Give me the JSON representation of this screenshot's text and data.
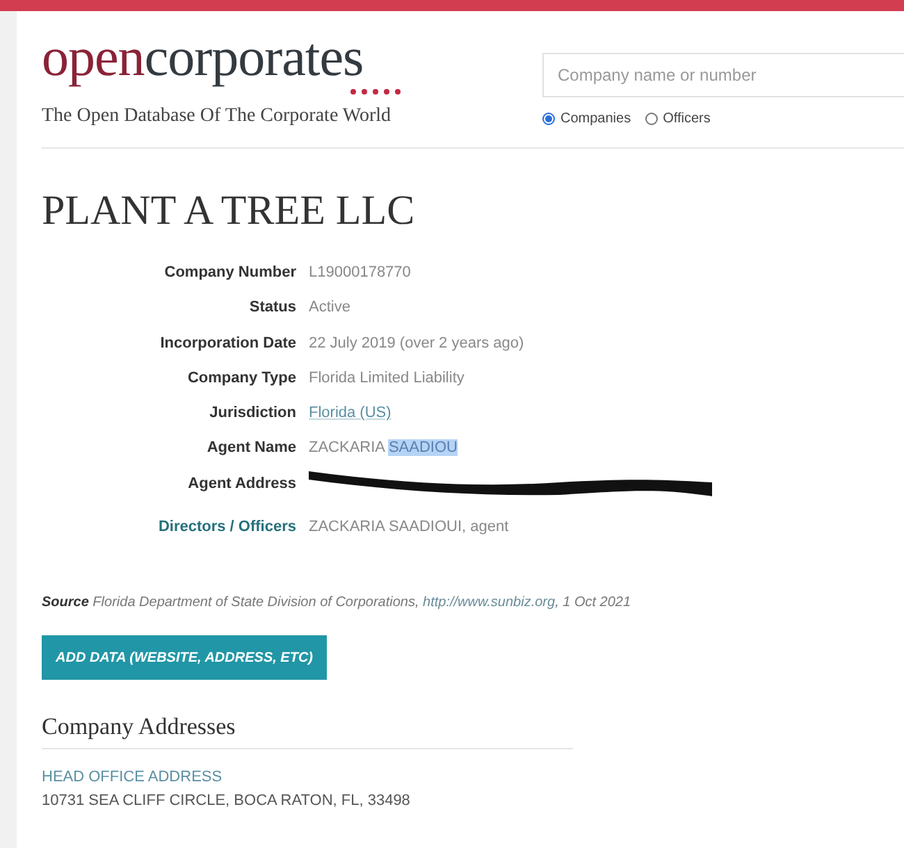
{
  "banner": {
    "kind": "alert"
  },
  "logo": {
    "part_1": "open",
    "part_2": "corporates",
    "tagline": "The Open Database Of The Corporate World"
  },
  "search": {
    "placeholder": "Company name or number",
    "options": [
      {
        "label": "Companies",
        "selected": true
      },
      {
        "label": "Officers",
        "selected": false
      }
    ]
  },
  "company": {
    "name": "PLANT A TREE LLC",
    "rows": [
      {
        "label": "Company Number",
        "label_link": false,
        "kind": "text",
        "parts": [
          {
            "text": "L19000178770",
            "highlighted": false
          }
        ]
      },
      {
        "label": "Status",
        "label_link": false,
        "kind": "text",
        "parts": [
          {
            "text": "Active",
            "highlighted": false
          }
        ]
      },
      {
        "label": "Incorporation Date",
        "label_link": false,
        "kind": "text",
        "parts": [
          {
            "text": "22 July 2019 (over 2 years ago)",
            "highlighted": false
          }
        ]
      },
      {
        "label": "Company Type",
        "label_link": false,
        "kind": "text",
        "parts": [
          {
            "text": "Florida Limited Liability",
            "highlighted": false
          }
        ]
      },
      {
        "label": "Jurisdiction",
        "label_link": false,
        "kind": "link",
        "parts": [
          {
            "text": "Florida (US)",
            "highlighted": false
          }
        ]
      },
      {
        "label": "Agent Name",
        "label_link": false,
        "kind": "text",
        "parts": [
          {
            "text": "ZACKARIA ",
            "highlighted": false
          },
          {
            "text": "SAADIOU",
            "highlighted": true
          }
        ]
      },
      {
        "label": "Agent Address",
        "label_link": false,
        "kind": "redacted"
      },
      {
        "label": "Directors / Officers",
        "label_link": true,
        "kind": "text",
        "parts": [
          {
            "text": "ZACKARIA SAADIOUI",
            "highlighted": false
          },
          {
            "text": ", agent",
            "highlighted": false
          }
        ]
      }
    ]
  },
  "source": {
    "label": "Source",
    "text": "Florida Department of State Division of Corporations,",
    "link": "http://www.sunbiz.org",
    "date": ", 1 Oct 2021"
  },
  "add_data_button": "ADD DATA (WEBSITE, ADDRESS, ETC)",
  "addresses": {
    "heading": "Company Addresses",
    "items": [
      {
        "label": "HEAD OFFICE ADDRESS",
        "value": "10731 SEA CLIFF CIRCLE, BOCA RATON, FL, 33498"
      }
    ]
  }
}
